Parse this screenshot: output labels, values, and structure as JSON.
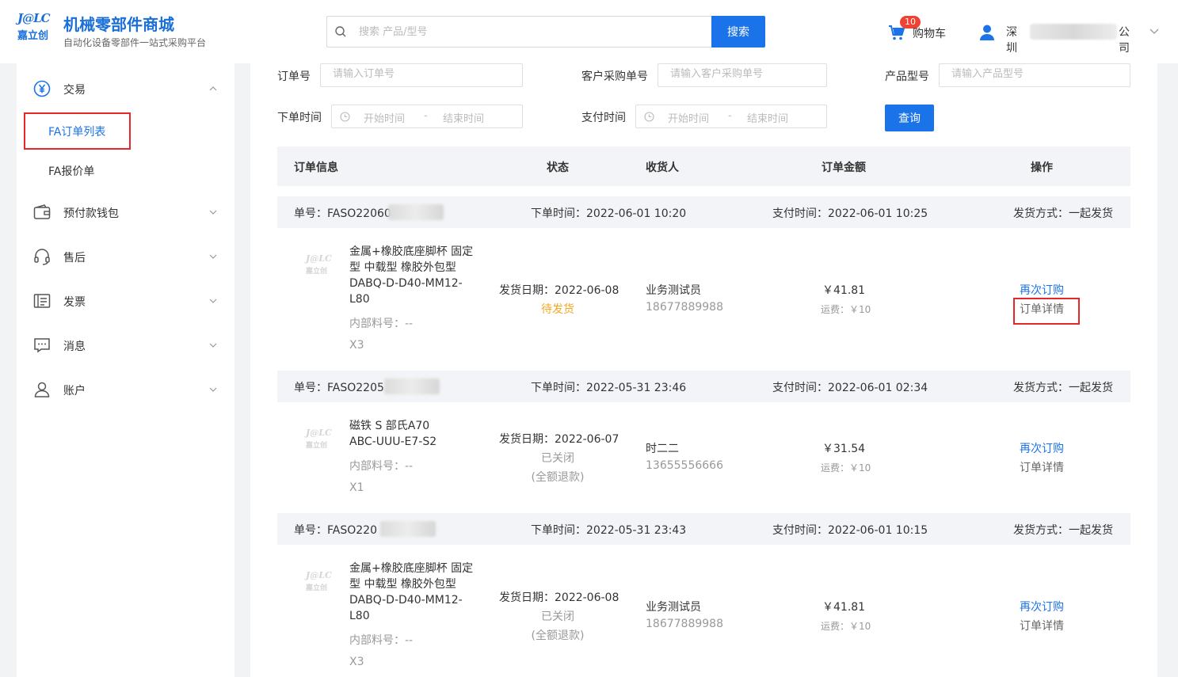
{
  "header": {
    "logo_mark": "J@LC",
    "logo_cn": "嘉立创",
    "site_title": "机械零部件商城",
    "site_subtitle": "自动化设备零部件一站式采购平台",
    "search_placeholder": "搜索 产品/型号",
    "search_button": "搜索",
    "cart_count": "10",
    "cart_label": "购物车",
    "company_prefix": "深圳",
    "company_suffix": "公司"
  },
  "sidebar": {
    "trade": "交易",
    "fa_orders": "FA订单列表",
    "fa_quotes": "FA报价单",
    "wallet": "预付款钱包",
    "after_sales": "售后",
    "invoice": "发票",
    "messages": "消息",
    "account": "账户"
  },
  "filters": {
    "order_no_label": "订单号",
    "order_no_placeholder": "请输入订单号",
    "cust_po_label": "客户采购单号",
    "cust_po_placeholder": "请输入客户采购单号",
    "model_label": "产品型号",
    "model_placeholder": "请输入产品型号",
    "order_time_label": "下单时间",
    "pay_time_label": "支付时间",
    "start_time": "开始时间",
    "end_time": "结束时间",
    "dash": "-",
    "query_button": "查询"
  },
  "table_headers": {
    "info": "订单信息",
    "status": "状态",
    "receiver": "收货人",
    "amount": "订单金额",
    "ops": "操作"
  },
  "orders": [
    {
      "order_no": "单号：FASO22060",
      "order_time": "下单时间：2022-06-01 10:20",
      "pay_time": "支付时间：2022-06-01 10:25",
      "ship_mode": "发货方式：一起发货",
      "product_name": "金属+橡胶底座脚杯 固定型 中载型 橡胶外包型 DABQ-D-D40-MM12-L80",
      "part_no": "内部料号：--",
      "qty": "X3",
      "ship_date": "发货日期：2022-06-08",
      "status": "待发货",
      "status_note": "",
      "receiver": "业务测试员",
      "phone": "18677889988",
      "amount": "￥41.81",
      "freight": "运费：￥10",
      "reorder": "再次订购",
      "detail": "订单详情"
    },
    {
      "order_no": "单号：FASO2205",
      "order_time": "下单时间：2022-05-31 23:46",
      "pay_time": "支付时间：2022-06-01 02:34",
      "ship_mode": "发货方式：一起发货",
      "product_name": "磁铁 S 部氏A70 ABC-UUU-E7-S2",
      "part_no": "内部料号：--",
      "qty": "X1",
      "ship_date": "发货日期：2022-06-07",
      "status": "已关闭",
      "status_note": "(全额退款)",
      "receiver": "时二二",
      "phone": "13655556666",
      "amount": "￥31.54",
      "freight": "运费：￥10",
      "reorder": "再次订购",
      "detail": "订单详情"
    },
    {
      "order_no": "单号：FASO220",
      "order_time": "下单时间：2022-05-31 23:43",
      "pay_time": "支付时间：2022-06-01 10:15",
      "ship_mode": "发货方式：一起发货",
      "product_name": "金属+橡胶底座脚杯 固定型 中载型 橡胶外包型 DABQ-D-D40-MM12-L80",
      "part_no": "内部料号：--",
      "qty": "X3",
      "ship_date": "发货日期：2022-06-08",
      "status": "已关闭",
      "status_note": "(全额退款)",
      "receiver": "业务测试员",
      "phone": "18677889988",
      "amount": "￥41.81",
      "freight": "运费：￥10",
      "reorder": "再次订购",
      "detail": "订单详情"
    }
  ],
  "colors": {
    "brand": "#1a73e8",
    "highlight": "#e5262b",
    "pending": "#f5a623"
  }
}
